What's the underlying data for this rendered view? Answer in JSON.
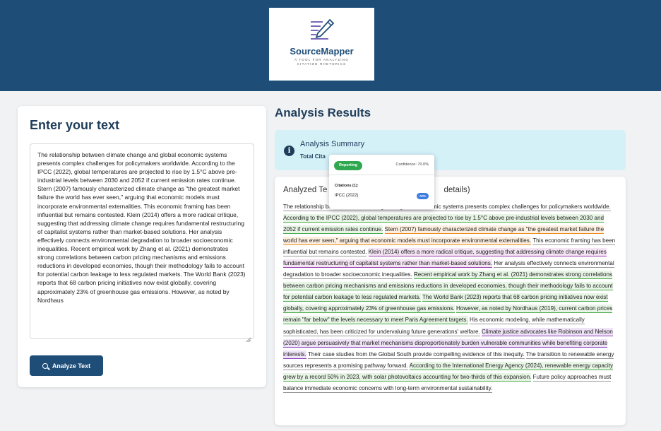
{
  "header": {
    "logo_title": "SourceMapper",
    "logo_tagline": "A TOOL FOR ANALYZING CITATION RHETORICS",
    "logo_icon": "pencil-lines-icon"
  },
  "input_panel": {
    "title": "Enter your text",
    "text": "The relationship between climate change and global economic systems presents complex challenges for policymakers worldwide. According to the IPCC (2022), global temperatures are projected to rise by 1.5°C above pre-industrial levels between 2030 and 2052 if current emission rates continue. Stern (2007) famously characterized climate change as \"the greatest market failure the world has ever seen,\" arguing that economic models must incorporate environmental externalities. This economic framing has been influential but remains contested. Klein (2014) offers a more radical critique, suggesting that addressing climate change requires fundamental restructuring of capitalist systems rather than market-based solutions. Her analysis effectively connects environmental degradation to broader socioeconomic inequalities. Recent empirical work by Zhang et al. (2021) demonstrates strong correlations between carbon pricing mechanisms and emissions reductions in developed economies, though their methodology fails to account for potential carbon leakage to less regulated markets. The World Bank (2023) reports that 68 carbon pricing initiatives now exist globally, covering approximately 23% of greenhouse gas emissions. However, as noted by Nordhaus",
    "analyze_button": "Analyze Text"
  },
  "results": {
    "title": "Analysis Results",
    "summary_title": "Analysis Summary",
    "summary_sub": "Total Cita",
    "analyzed_title": "Analyzed Te",
    "analyzed_title_tail": "details)",
    "segments": [
      {
        "type": "plain",
        "text": "The relationship"
      },
      {
        "type": "plain",
        "text": " between climate change and global economic systems presents complex challenges for policymakers worldwide."
      },
      {
        "type": "space",
        "text": " "
      },
      {
        "type": "green",
        "text": "According to the IPCC (2022), global temperatures are projected to rise by 1.5°C above pre-industrial levels between 2030 and 2052 if current emission rates continue."
      },
      {
        "type": "space",
        "text": " "
      },
      {
        "type": "orange",
        "text": "Stern (2007) famously characterized climate change as \"the greatest market failure the world has ever seen,\" arguing that economic models must incorporate environmental externalities."
      },
      {
        "type": "space",
        "text": " "
      },
      {
        "type": "plain",
        "text": "This economic framing has been influential but remains contested."
      },
      {
        "type": "space",
        "text": " "
      },
      {
        "type": "purple",
        "text": "Klein (2014) offers a more radical critique, suggesting that addressing climate change requires fundamental restructuring of capitalist systems rather than market-based solutions."
      },
      {
        "type": "space",
        "text": " "
      },
      {
        "type": "plain",
        "text": "Her analysis effectively connects environmental degradation to broader socioeconomic inequalities."
      },
      {
        "type": "space",
        "text": " "
      },
      {
        "type": "green",
        "text": "Recent empirical work by Zhang et al. (2021) demonstrates strong correlations between carbon pricing mechanisms and emissions reductions in developed economies, though their methodology fails to account for potential carbon leakage to less regulated markets."
      },
      {
        "type": "space",
        "text": " "
      },
      {
        "type": "green",
        "text": "The World Bank (2023) reports that 68 carbon pricing initiatives now exist globally, covering approximately 23% of greenhouse gas emissions."
      },
      {
        "type": "space",
        "text": " "
      },
      {
        "type": "green",
        "text": "However, as noted by Nordhaus (2019), current carbon prices remain \"far below\" the levels necessary to meet Paris Agreement targets."
      },
      {
        "type": "space",
        "text": " "
      },
      {
        "type": "plain",
        "text": "His economic modeling, while mathematically sophisticated, has been criticized for undervaluing future generations' welfare."
      },
      {
        "type": "space",
        "text": " "
      },
      {
        "type": "purple2",
        "text": "Climate justice advocates like Robinson and Nelson (2020) argue persuasively that market mechanisms disproportionately burden vulnerable communities while benefiting corporate interests."
      },
      {
        "type": "space",
        "text": " "
      },
      {
        "type": "plain",
        "text": "Their case studies from the Global South provide compelling evidence of this inequity."
      },
      {
        "type": "space",
        "text": " "
      },
      {
        "type": "plain",
        "text": "The transition to renewable energy sources represents a promising pathway forward."
      },
      {
        "type": "space",
        "text": " "
      },
      {
        "type": "green",
        "text": "According to the International Energy Agency (2024), renewable energy capacity grew by a record 50% in 2023, with solar photovoltaics accounting for two-thirds of this expansion."
      },
      {
        "type": "space",
        "text": " "
      },
      {
        "type": "plain",
        "text": "Future policy approaches must balance immediate economic concerns with long-term environmental sustainability."
      }
    ]
  },
  "tooltip": {
    "tag": "Reporting",
    "confidence": "Confidence: 70.0%",
    "citations_label": "Citations (1):",
    "citation": "IPCC (2022)",
    "badge": "APA"
  },
  "colors": {
    "header_bg": "#1e4d78",
    "summary_bg": "#d4f1f8",
    "reporting_green": "#2fa84f",
    "apa_blue": "#3d7de0"
  }
}
